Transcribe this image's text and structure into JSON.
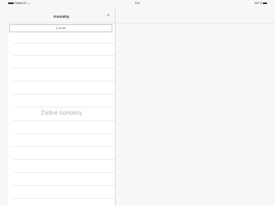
{
  "status_bar": {
    "carrier": "Fldeta 3G  —",
    "time": "9:41",
    "battery": "100 %"
  },
  "contacts": {
    "title": "Kontakty",
    "add_icon": "plus-icon",
    "search_placeholder": "Q Hledat",
    "empty_message": "Žádné kontakty"
  },
  "colors": {
    "accent": "#4a90e2",
    "background": "#f7f7f7",
    "list_background": "#ffffff",
    "divider": "#ececec"
  }
}
